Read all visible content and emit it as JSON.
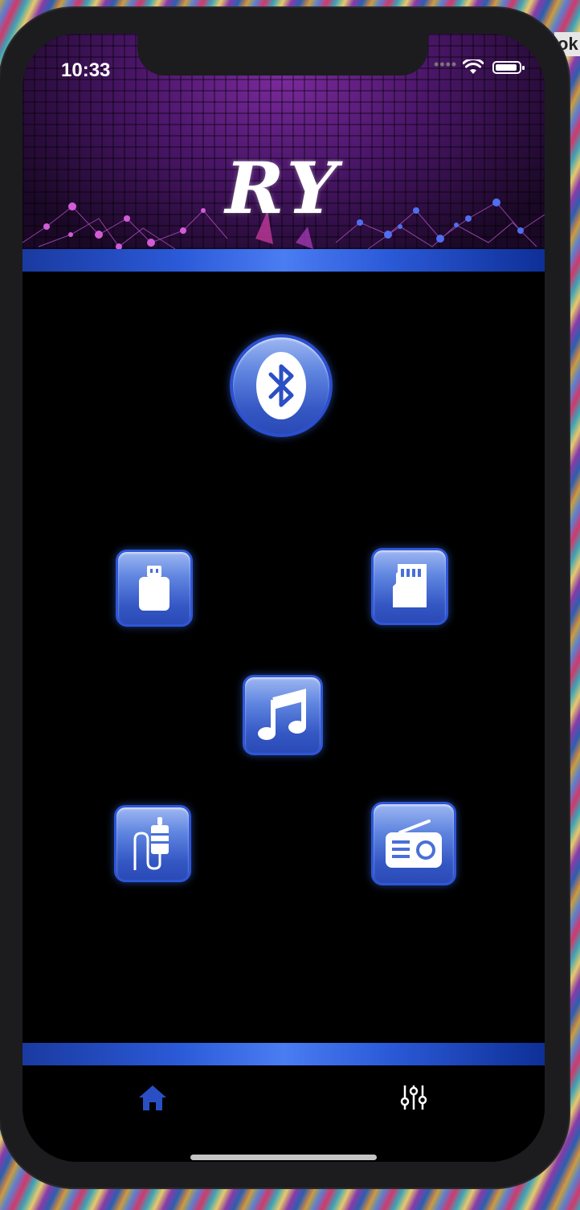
{
  "status_bar": {
    "time": "10:33"
  },
  "app": {
    "logo": "RY"
  },
  "sources": [
    {
      "id": "bluetooth",
      "icon": "bluetooth-icon"
    },
    {
      "id": "usb",
      "icon": "usb-drive-icon"
    },
    {
      "id": "sd-card",
      "icon": "sd-card-icon"
    },
    {
      "id": "music",
      "icon": "music-note-icon"
    },
    {
      "id": "aux",
      "icon": "aux-cable-icon"
    },
    {
      "id": "radio",
      "icon": "radio-icon"
    }
  ],
  "tab_bar": {
    "tabs": [
      {
        "id": "home",
        "icon": "home-icon",
        "active": true
      },
      {
        "id": "equalizer",
        "icon": "sliders-icon",
        "active": false
      }
    ]
  },
  "colors": {
    "accent": "#2f56d8",
    "tab_active": "#2a4fc4",
    "tab_inactive": "#ffffff"
  }
}
